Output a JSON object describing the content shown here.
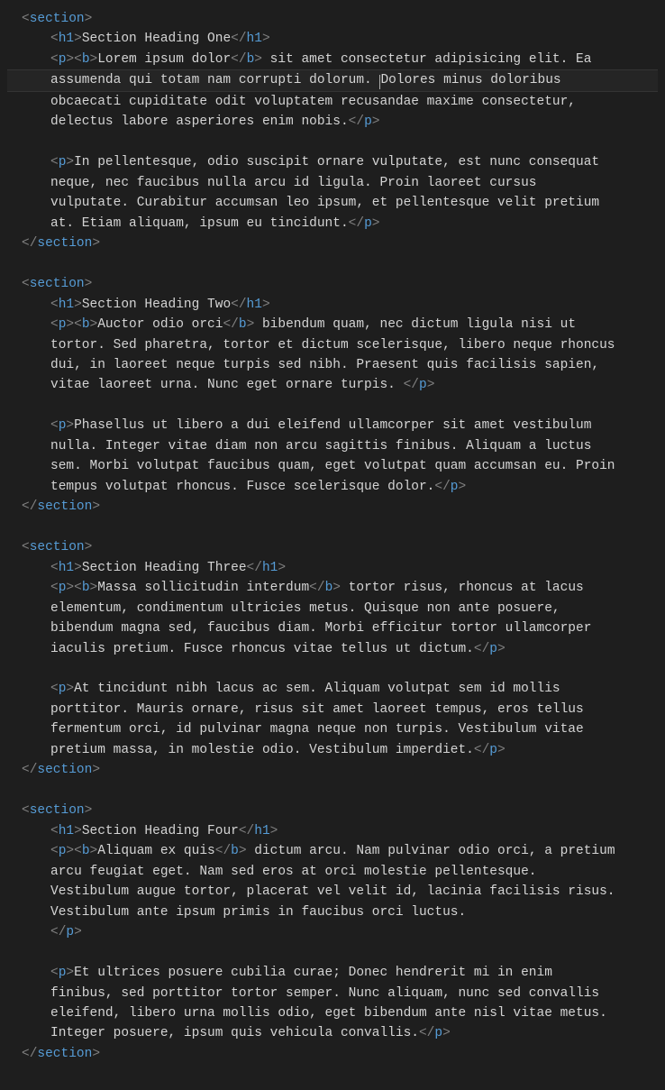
{
  "colors": {
    "bg": "#1e1e1e",
    "fg": "#d4d4d4",
    "tag": "#569cd6",
    "punct": "#808080"
  },
  "cursor": {
    "section": 0,
    "afterText": "assumenda qui totam nam corrupti dolorum. "
  },
  "sections": [
    {
      "heading": "Section Heading One",
      "boldLead": "Lorem ipsum dolor",
      "p1": " sit amet consectetur adipisicing elit. Ea assumenda qui totam nam corrupti dolorum. Dolores minus doloribus obcaecati cupiditate odit voluptatem recusandae maxime consectetur, delectus labore asperiores enim nobis.",
      "p2": "In pellentesque, odio suscipit ornare vulputate, est nunc consequat neque, nec faucibus nulla arcu id ligula. Proin laoreet cursus vulputate. Curabitur accumsan leo ipsum, et pellentesque velit pretium at. Etiam aliquam, ipsum eu tincidunt."
    },
    {
      "heading": "Section Heading Two",
      "boldLead": "Auctor odio orci",
      "p1": " bibendum quam, nec dictum ligula nisi ut tortor. Sed pharetra, tortor et dictum scelerisque, libero neque rhoncus dui, in laoreet neque turpis sed nibh. Praesent quis facilisis sapien, vitae laoreet urna. Nunc eget ornare turpis. ",
      "p2": "Phasellus ut libero a dui eleifend ullamcorper sit amet vestibulum nulla. Integer vitae diam non arcu sagittis finibus. Aliquam a luctus sem. Morbi volutpat faucibus quam, eget volutpat quam accumsan eu. Proin tempus volutpat rhoncus. Fusce scelerisque dolor."
    },
    {
      "heading": "Section Heading Three",
      "boldLead": "Massa sollicitudin interdum",
      "p1": " tortor risus, rhoncus at lacus elementum, condimentum ultricies metus. Quisque non ante posuere, bibendum magna sed, faucibus diam. Morbi efficitur tortor ullamcorper iaculis pretium. Fusce rhoncus vitae tellus ut dictum.",
      "p2": "At tincidunt nibh lacus ac sem. Aliquam volutpat sem id mollis porttitor. Mauris ornare, risus sit amet laoreet tempus, eros tellus fermentum orci, id pulvinar magna neque non turpis. Vestibulum vitae pretium massa, in molestie odio. Vestibulum imperdiet."
    },
    {
      "heading": "Section Heading Four",
      "boldLead": "Aliquam ex quis",
      "p1": " dictum arcu. Nam pulvinar odio orci, a pretium arcu feugiat eget. Nam sed eros at orci molestie pellentesque. Vestibulum augue tortor, placerat vel velit id, lacinia facilisis risus. Vestibulum ante ipsum primis in faucibus orci luctus.",
      "closeOnNewLine": true,
      "p2": "Et ultrices posuere cubilia curae; Donec hendrerit mi in enim finibus, sed porttitor tortor semper. Nunc aliquam, nunc sed convallis eleifend, libero urna mollis odio, eget bibendum ante nisl vitae metus. Integer posuere, ipsum quis vehicula convallis."
    }
  ]
}
